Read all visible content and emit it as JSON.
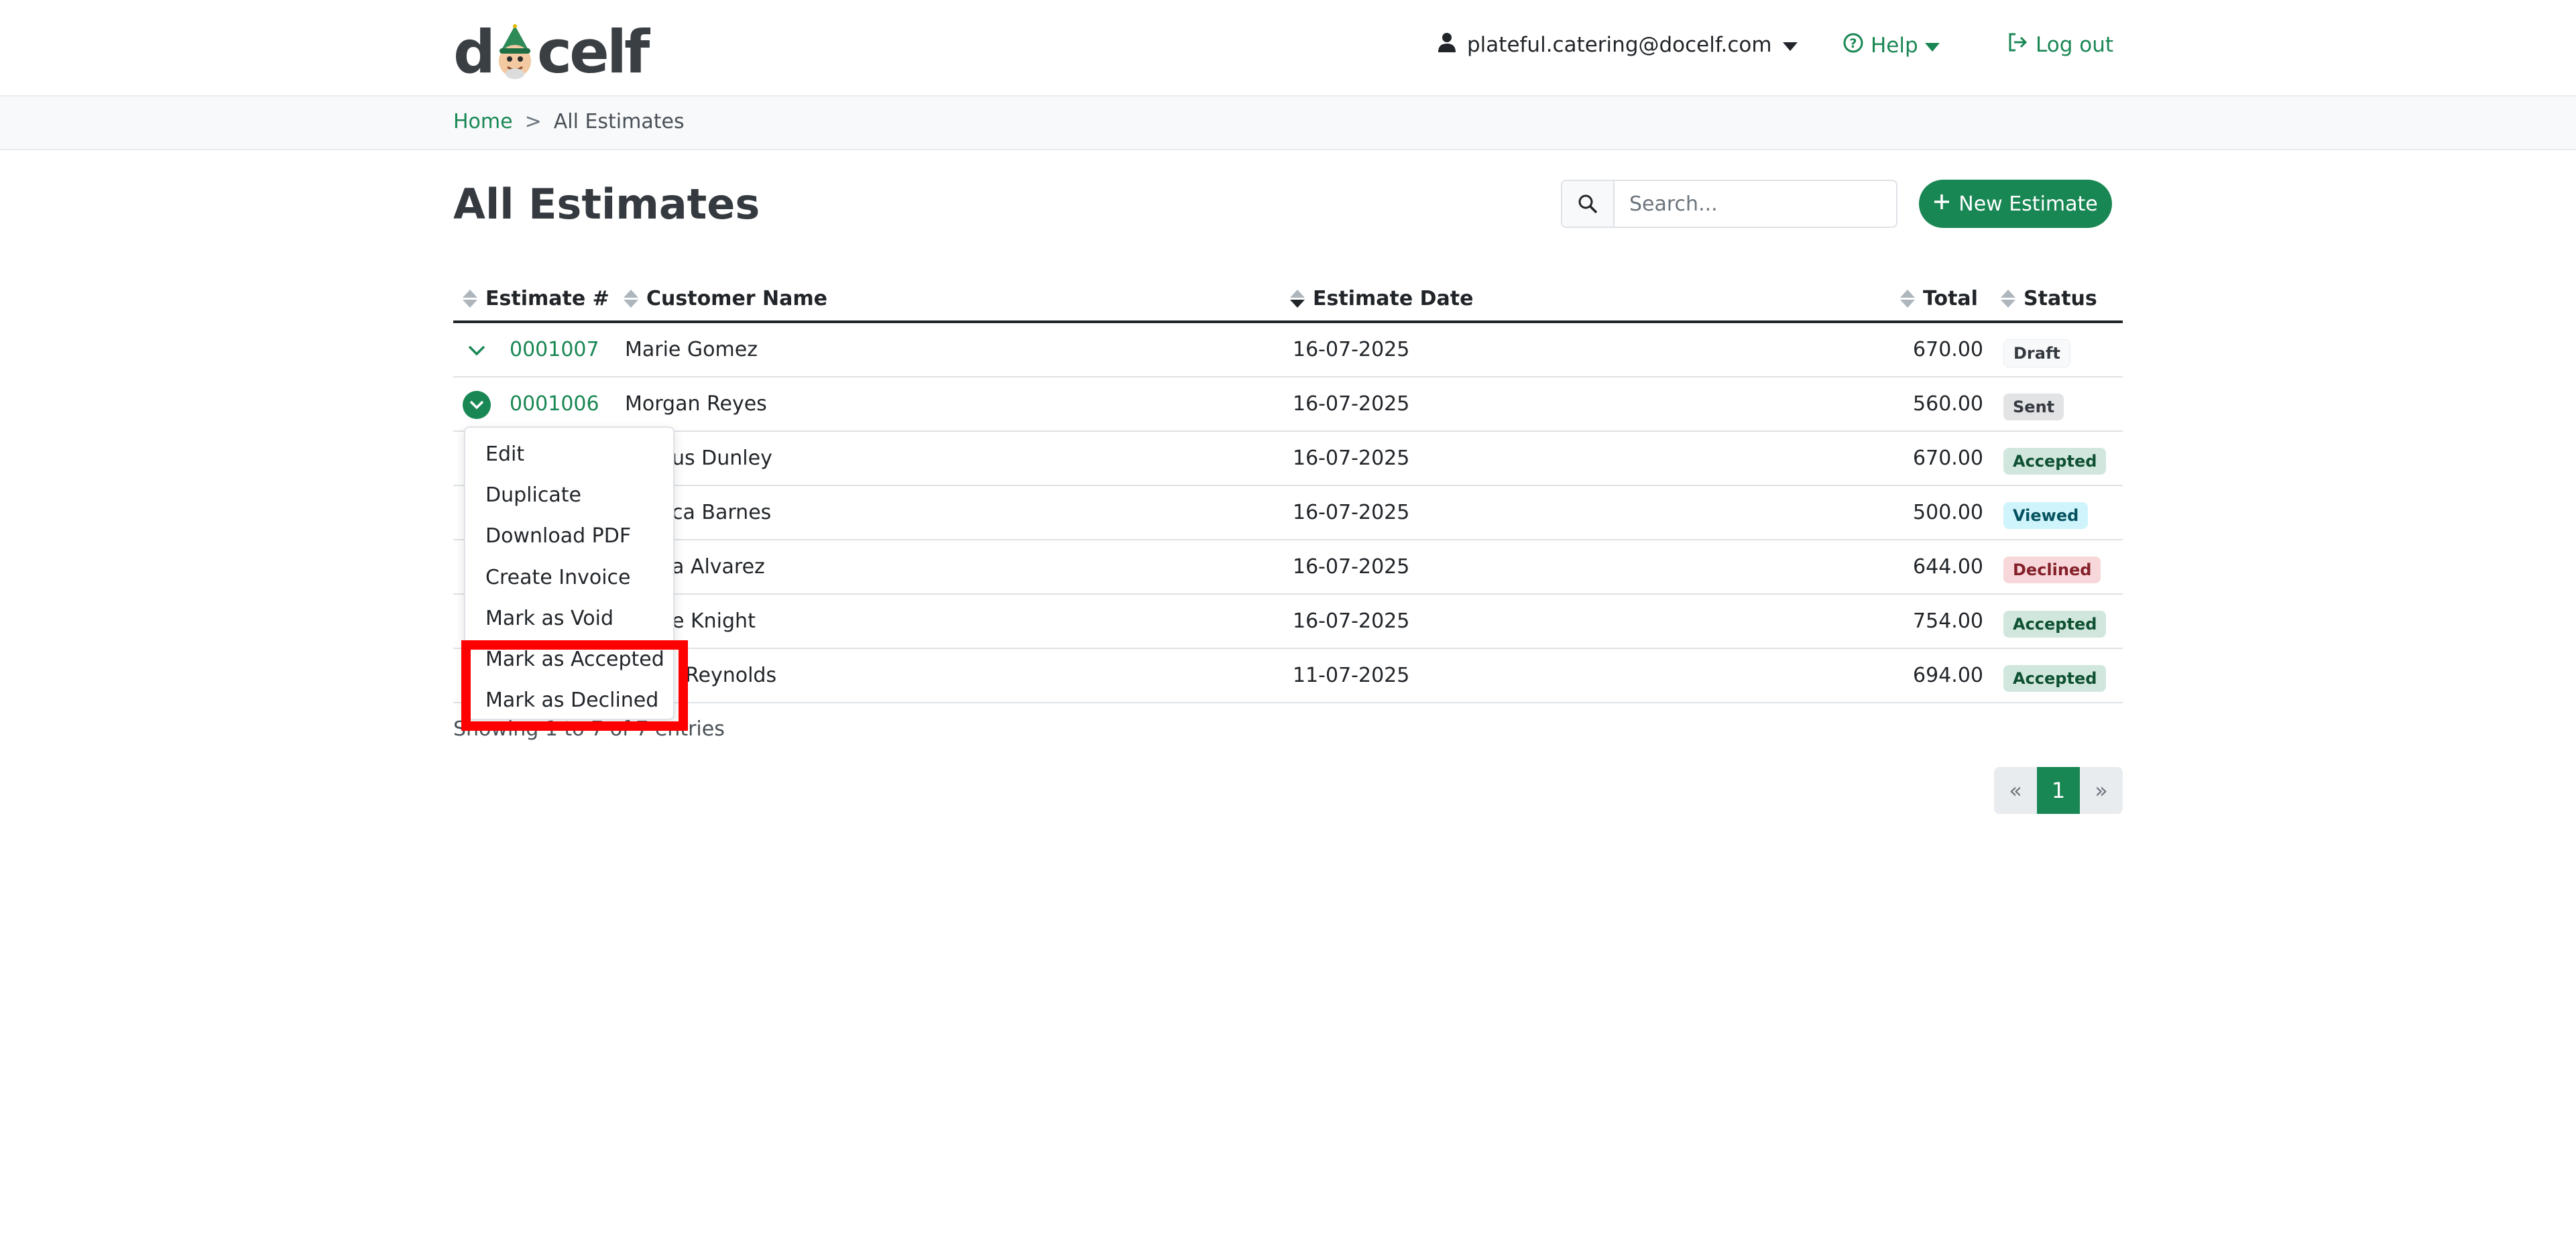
{
  "header": {
    "logo_text_left": "d",
    "logo_text_right": "celf",
    "user_email": "plateful.catering@docelf.com",
    "help_label": "Help",
    "logout_label": "Log out"
  },
  "breadcrumb": {
    "home": "Home",
    "separator": ">",
    "current": "All Estimates"
  },
  "page": {
    "title": "All Estimates",
    "search_placeholder": "Search...",
    "new_button": "New Estimate"
  },
  "table": {
    "headers": {
      "estimate": "Estimate #",
      "customer": "Customer Name",
      "date": "Estimate Date",
      "total": "Total",
      "status": "Status"
    },
    "rows": [
      {
        "number": "0001007",
        "customer": "Marie Gomez",
        "date": "16-07-2025",
        "total": "670.00",
        "status": "Draft"
      },
      {
        "number": "0001006",
        "customer": "Morgan Reyes",
        "date": "16-07-2025",
        "total": "560.00",
        "status": "Sent"
      },
      {
        "number": "",
        "customer": "us Dunley",
        "date": "16-07-2025",
        "total": "670.00",
        "status": "Accepted"
      },
      {
        "number": "",
        "customer": "ca Barnes",
        "date": "16-07-2025",
        "total": "500.00",
        "status": "Viewed"
      },
      {
        "number": "",
        "customer": "a Alvarez",
        "date": "16-07-2025",
        "total": "644.00",
        "status": "Declined"
      },
      {
        "number": "",
        "customer": "e Knight",
        "date": "16-07-2025",
        "total": "754.00",
        "status": "Accepted"
      },
      {
        "number": "",
        "customer": "Reynolds",
        "date": "11-07-2025",
        "total": "694.00",
        "status": "Accepted"
      }
    ],
    "showing_text": "Showing 1 to 7 of 7 entries"
  },
  "pagination": {
    "prev": "«",
    "current": "1",
    "next": "»"
  },
  "dropdown": {
    "items": [
      "Edit",
      "Duplicate",
      "Download PDF",
      "Create Invoice",
      "Mark as Void",
      "Mark as Accepted",
      "Mark as Declined"
    ]
  },
  "colors": {
    "accent": "#198754",
    "highlight": "#ff0000"
  }
}
